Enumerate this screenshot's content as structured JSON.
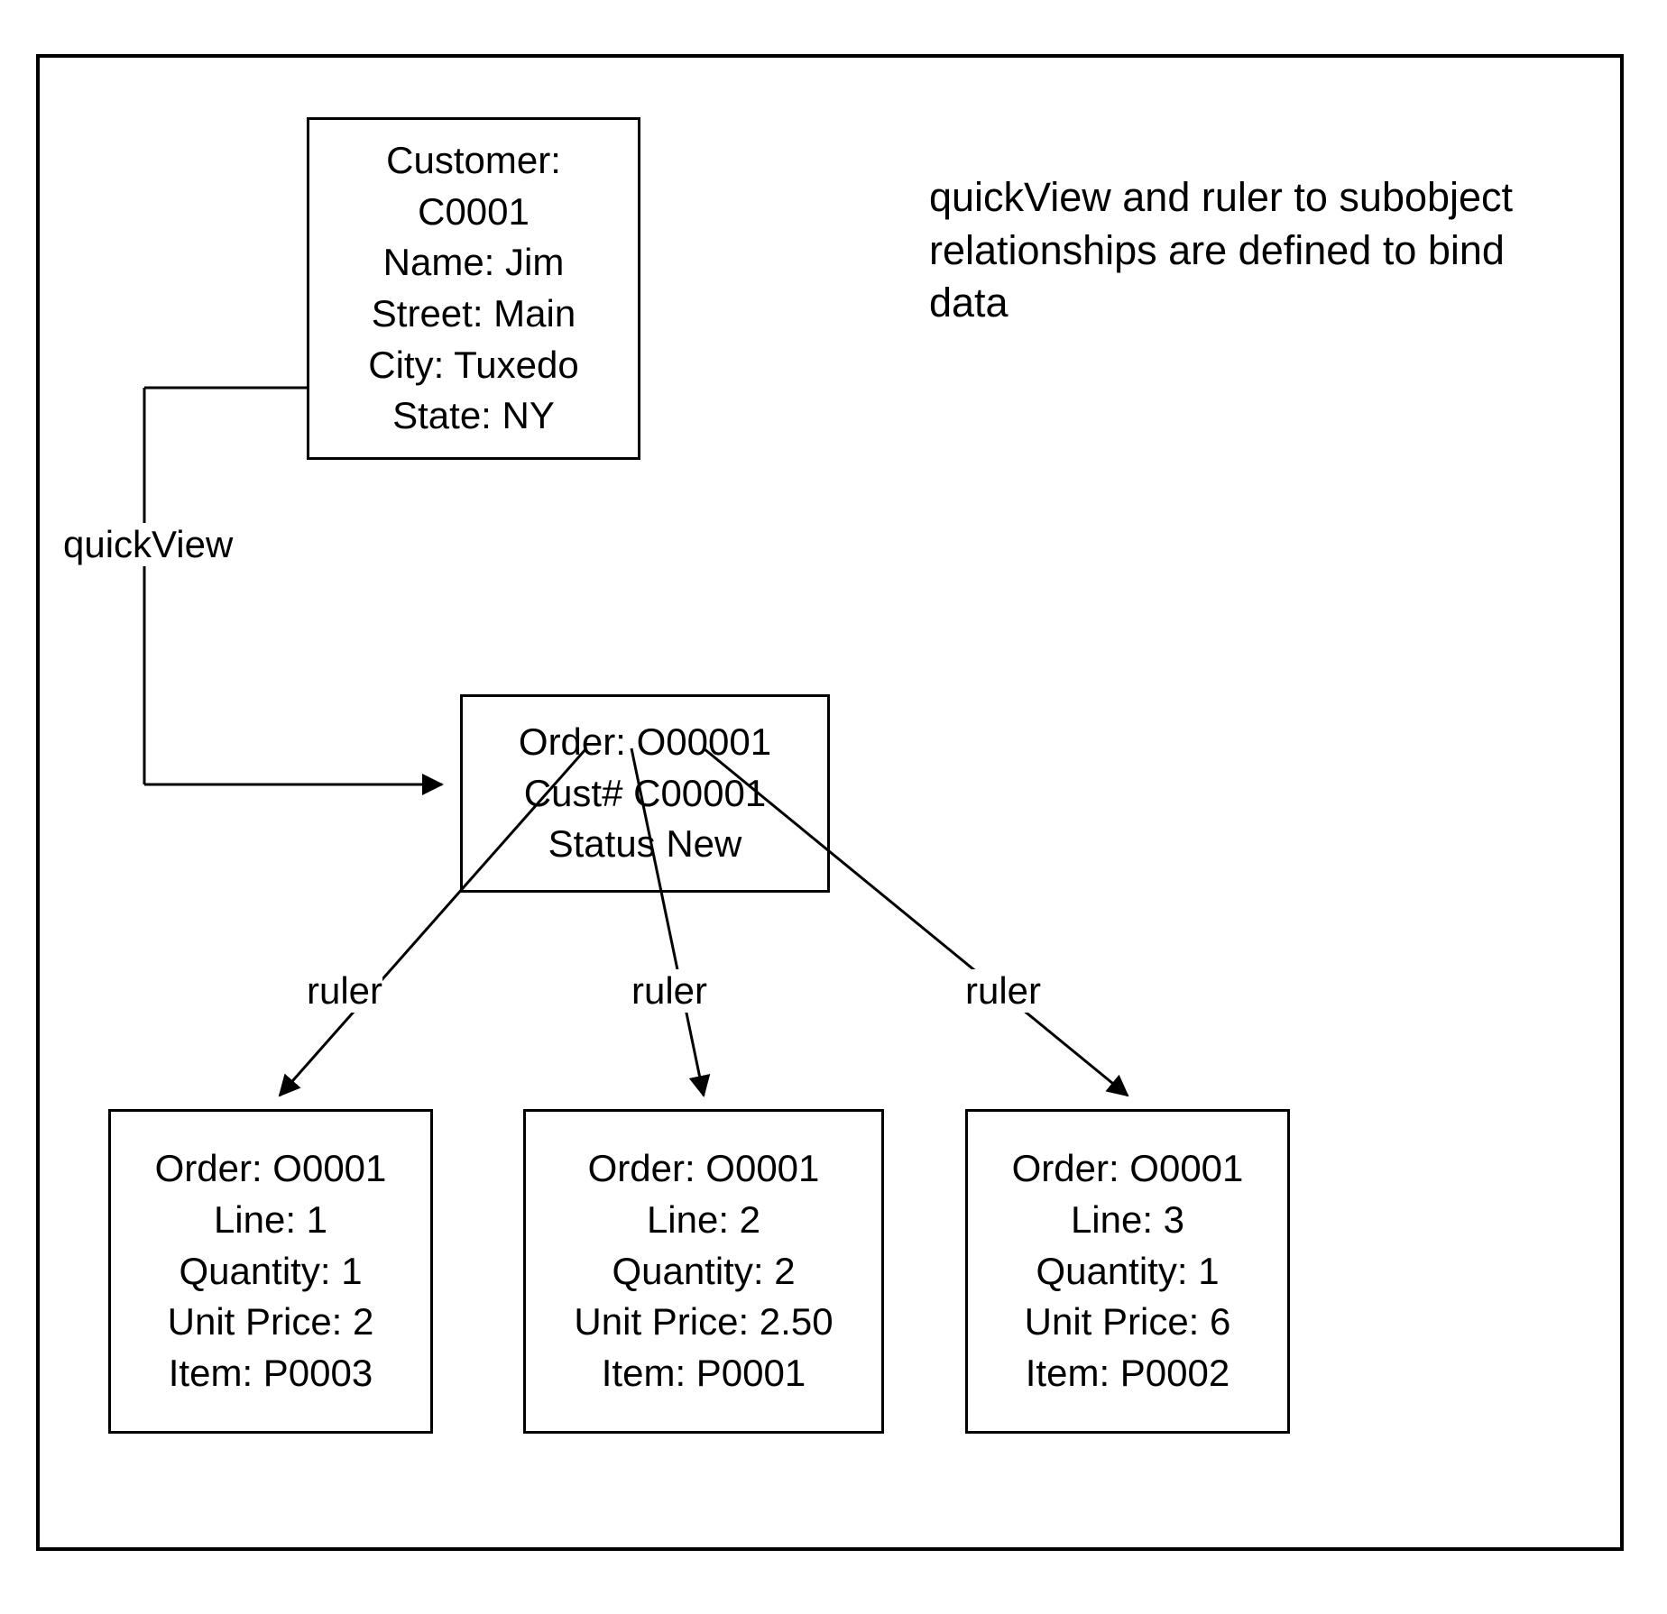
{
  "caption": "quickView and ruler to subobject relationships are defined to bind data",
  "edge_labels": {
    "quickview": "quickView",
    "ruler1": "ruler",
    "ruler2": "ruler",
    "ruler3": "ruler"
  },
  "customer": {
    "l1": "Customer:",
    "l2": "C0001",
    "l3": "Name: Jim",
    "l4": "Street: Main",
    "l5": "City: Tuxedo",
    "l6": "State: NY"
  },
  "order": {
    "l1": "Order: O00001",
    "l2": "Cust# C00001",
    "l3": "Status New"
  },
  "line1": {
    "l1": "Order: O0001",
    "l2": "Line: 1",
    "l3": "Quantity: 1",
    "l4": "Unit Price: 2",
    "l5": "Item: P0003"
  },
  "line2": {
    "l1": "Order: O0001",
    "l2": "Line: 2",
    "l3": "Quantity: 2",
    "l4": "Unit Price: 2.50",
    "l5": "Item: P0001"
  },
  "line3": {
    "l1": "Order: O0001",
    "l2": "Line: 3",
    "l3": "Quantity: 1",
    "l4": "Unit Price: 6",
    "l5": "Item: P0002"
  }
}
